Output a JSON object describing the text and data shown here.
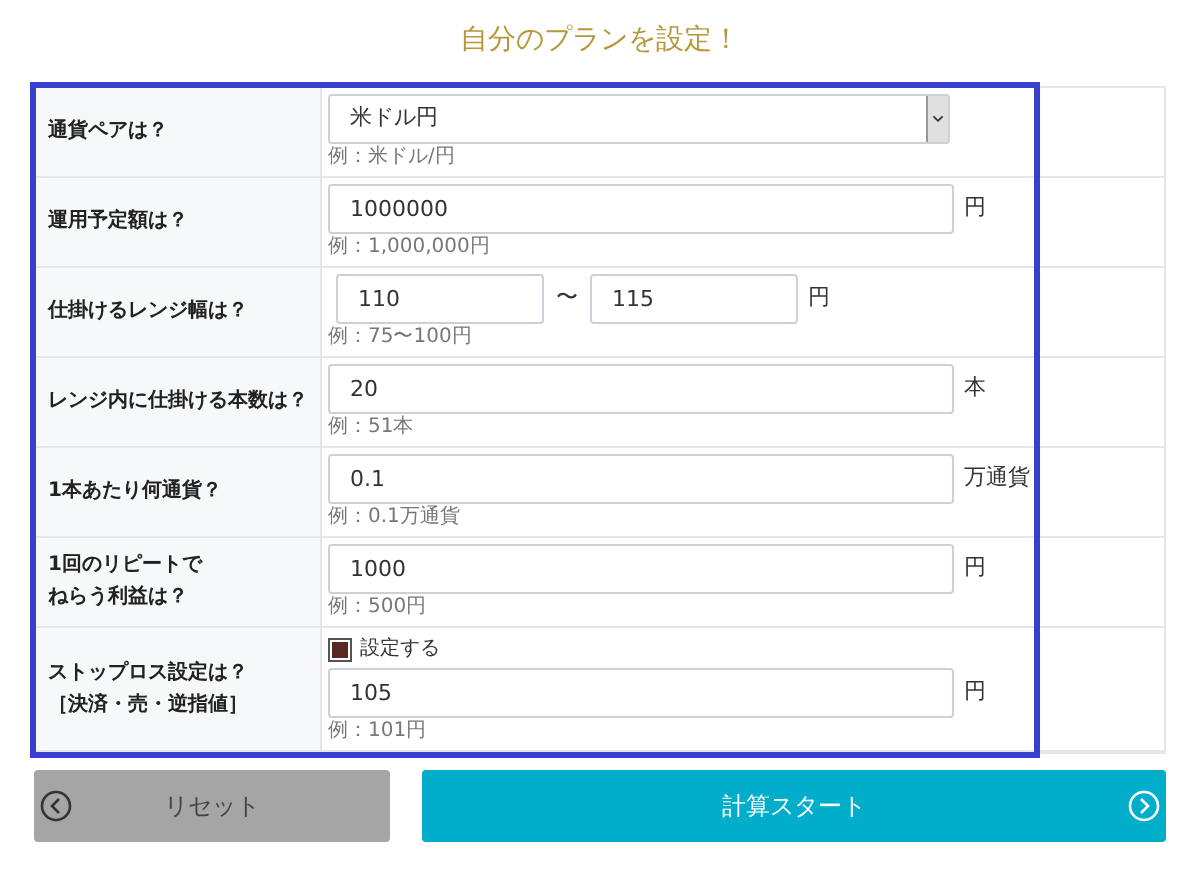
{
  "title": "自分のプランを設定！",
  "rows": [
    {
      "kind": "select",
      "label": "通貨ペアは？",
      "value": "米ドル円",
      "hint": "例：米ドル/円"
    },
    {
      "kind": "text",
      "label": "運用予定額は？",
      "value": "1000000",
      "unit": "円",
      "hint": "例：1,000,000円"
    },
    {
      "kind": "range",
      "label": "仕掛けるレンジ幅は？",
      "from": "110",
      "separator": "〜",
      "to": "115",
      "unit": "円",
      "hint": "例：75〜100円"
    },
    {
      "kind": "text",
      "label": "レンジ内に仕掛ける本数は？",
      "value": "20",
      "unit": "本",
      "hint": "例：51本"
    },
    {
      "kind": "text",
      "label": "1本あたり何通貨？",
      "value": "0.1",
      "unit": "万通貨",
      "hint": "例：0.1万通貨"
    },
    {
      "kind": "text",
      "label": [
        "1回のリピートで",
        "ねらう利益は？"
      ],
      "value": "1000",
      "unit": "円",
      "hint": "例：500円"
    },
    {
      "kind": "checkbox-text",
      "label": [
        "ストップロス設定は？",
        "［決済・売・逆指値］"
      ],
      "checkbox_label": "設定する",
      "checked": true,
      "value": "105",
      "unit": "円",
      "hint": "例：101円"
    }
  ],
  "buttons": [
    {
      "kind": "back",
      "label": "リセット"
    },
    {
      "kind": "next",
      "label": "計算スタート"
    }
  ]
}
